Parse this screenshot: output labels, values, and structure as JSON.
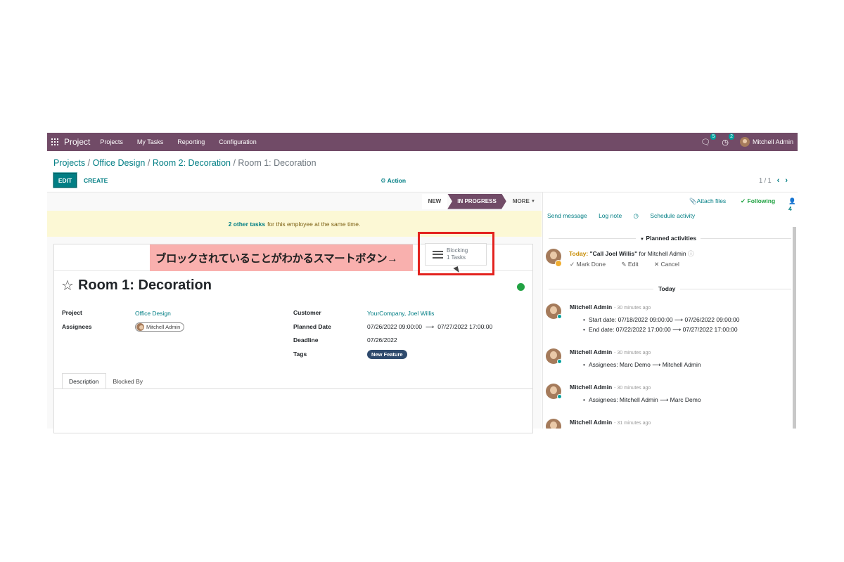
{
  "navbar": {
    "app_name": "Project",
    "menu": [
      "Projects",
      "My Tasks",
      "Reporting",
      "Configuration"
    ],
    "messages_badge": "5",
    "activities_badge": "2",
    "user": "Mitchell Admin"
  },
  "breadcrumb": {
    "items": [
      "Projects",
      "Office Design",
      "Room 2: Decoration"
    ],
    "current": "Room 1: Decoration"
  },
  "toolbar": {
    "edit_label": "EDIT",
    "create_label": "CREATE",
    "action_label": "Action",
    "pager": "1 / 1"
  },
  "statusbar": {
    "stages": [
      "NEW",
      "IN PROGRESS"
    ],
    "active_stage": "IN PROGRESS",
    "more_label": "MORE"
  },
  "alert": {
    "link_text": "2 other tasks",
    "text": "for this employee at the same time."
  },
  "annotation": {
    "banner_text": "ブロックされていることがわかるスマートボタン→",
    "highlight_color": "#e3221e"
  },
  "smart_button": {
    "label": "Blocking",
    "count": "1 Tasks"
  },
  "task": {
    "title": "Room 1: Decoration",
    "kanban_state_color": "#21a243",
    "fields_left": {
      "project_label": "Project",
      "project_value": "Office Design",
      "assignees_label": "Assignees",
      "assignee": "Mitchell Admin"
    },
    "fields_right": {
      "customer_label": "Customer",
      "customer_value": "YourCompany, Joel Willis",
      "planned_label": "Planned Date",
      "planned_start": "07/26/2022 09:00:00",
      "planned_end": "07/27/2022 17:00:00",
      "deadline_label": "Deadline",
      "deadline_value": "07/26/2022",
      "tags_label": "Tags",
      "tag": "New Feature"
    },
    "tabs": [
      "Description",
      "Blocked By"
    ]
  },
  "chatter": {
    "attach_label": "Attach files",
    "following_label": "Following",
    "followers_count": "4",
    "actions": [
      "Send message",
      "Log note",
      "Schedule activity"
    ],
    "planned_header": "Planned activities",
    "activity": {
      "today_label": "Today:",
      "summary": "\"Call Joel Willis\"",
      "for_text": "for Mitchell Admin",
      "buttons": [
        "Mark Done",
        "Edit",
        "Cancel"
      ]
    },
    "today_separator": "Today",
    "messages": [
      {
        "author": "Mitchell Admin",
        "time": "- 30 minutes ago",
        "items": [
          "Start date: 07/18/2022 09:00:00 ⟶ 07/26/2022 09:00:00",
          "End date: 07/22/2022 17:00:00 ⟶ 07/27/2022 17:00:00"
        ]
      },
      {
        "author": "Mitchell Admin",
        "time": "- 30 minutes ago",
        "items": [
          "Assignees: Marc Demo ⟶ Mitchell Admin"
        ]
      },
      {
        "author": "Mitchell Admin",
        "time": "- 30 minutes ago",
        "items": [
          "Assignees: Mitchell Admin ⟶ Marc Demo"
        ]
      },
      {
        "author": "Mitchell Admin",
        "time": "- 31 minutes ago",
        "items": []
      }
    ]
  }
}
